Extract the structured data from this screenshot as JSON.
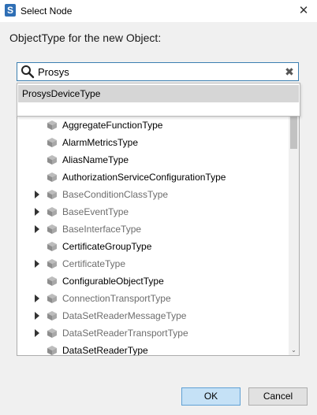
{
  "window": {
    "title": "Select Node",
    "app_icon_letter": "S",
    "close_symbol": "✕"
  },
  "prompt": "ObjectType for the new Object:",
  "search": {
    "value": "Prosys",
    "clear_symbol": "✖"
  },
  "suggestions": [
    "ProsysDeviceType"
  ],
  "tree": {
    "items": [
      {
        "label": "AggregateFunctionType",
        "expandable": false,
        "dimmed": false
      },
      {
        "label": "AlarmMetricsType",
        "expandable": false,
        "dimmed": false
      },
      {
        "label": "AliasNameType",
        "expandable": false,
        "dimmed": false
      },
      {
        "label": "AuthorizationServiceConfigurationType",
        "expandable": false,
        "dimmed": false
      },
      {
        "label": "BaseConditionClassType",
        "expandable": true,
        "dimmed": true
      },
      {
        "label": "BaseEventType",
        "expandable": true,
        "dimmed": true
      },
      {
        "label": "BaseInterfaceType",
        "expandable": true,
        "dimmed": true
      },
      {
        "label": "CertificateGroupType",
        "expandable": false,
        "dimmed": false
      },
      {
        "label": "CertificateType",
        "expandable": true,
        "dimmed": true
      },
      {
        "label": "ConfigurableObjectType",
        "expandable": false,
        "dimmed": false
      },
      {
        "label": "ConnectionTransportType",
        "expandable": true,
        "dimmed": true
      },
      {
        "label": "DataSetReaderMessageType",
        "expandable": true,
        "dimmed": true
      },
      {
        "label": "DataSetReaderTransportType",
        "expandable": true,
        "dimmed": true
      },
      {
        "label": "DataSetReaderType",
        "expandable": false,
        "dimmed": false
      }
    ],
    "scroll_down_symbol": "⌄"
  },
  "buttons": {
    "ok": "OK",
    "cancel": "Cancel"
  }
}
